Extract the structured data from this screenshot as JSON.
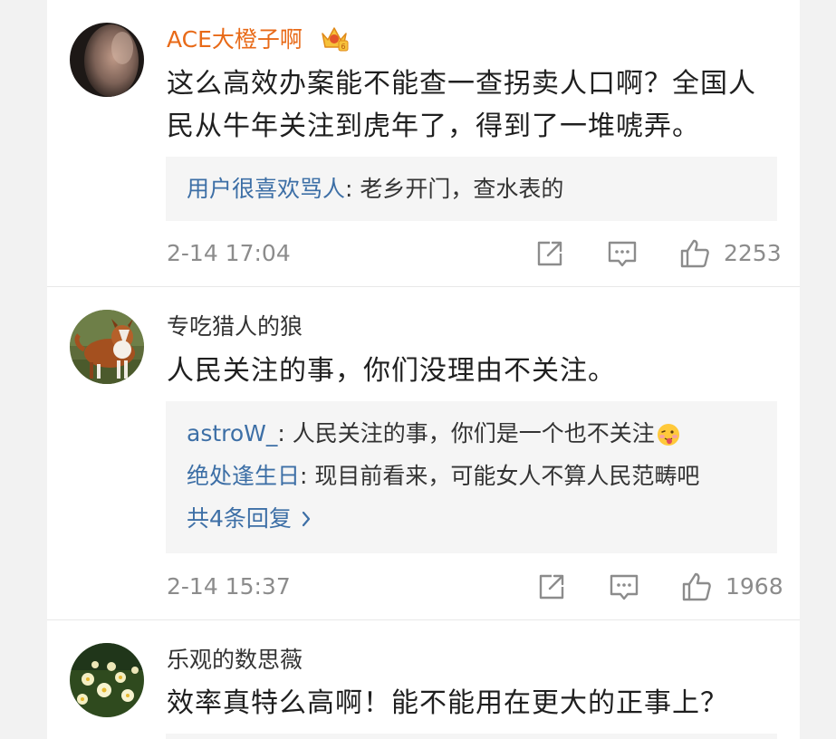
{
  "comments": [
    {
      "username": "ACE大橙子啊",
      "vip_badge": "crown-icon",
      "text": "这么高效办案能不能查一查拐卖人口啊？全国人民从牛年关注到虎年了，得到了一堆唬弄。",
      "replies": [
        {
          "name": "用户很喜欢骂人",
          "text": ": 老乡开门，查水表的"
        }
      ],
      "timestamp": "2-14 17:04",
      "likes": "2253"
    },
    {
      "username": "专吃猎人的狼",
      "text": "人民关注的事，你们没理由不关注。",
      "replies": [
        {
          "name": "astroW_",
          "text": ": 人民关注的事，你们是一个也不关注",
          "emoji": "tongue-out-emoji"
        },
        {
          "name": "绝处逢生日",
          "text": ": 现目前看来，可能女人不算人民范畴吧"
        }
      ],
      "more_replies": "共4条回复",
      "timestamp": "2-14 15:37",
      "likes": "1968"
    },
    {
      "username": "乐观的数思薇",
      "text": "效率真特么高啊！能不能用在更大的正事上？"
    }
  ],
  "colors": {
    "vip_name": "#e86a18",
    "reply_name": "#3d6fa6",
    "meta": "#8c8c8c",
    "reply_bg": "#f5f5f5"
  },
  "icons": [
    "share-icon",
    "comment-icon",
    "like-icon"
  ]
}
